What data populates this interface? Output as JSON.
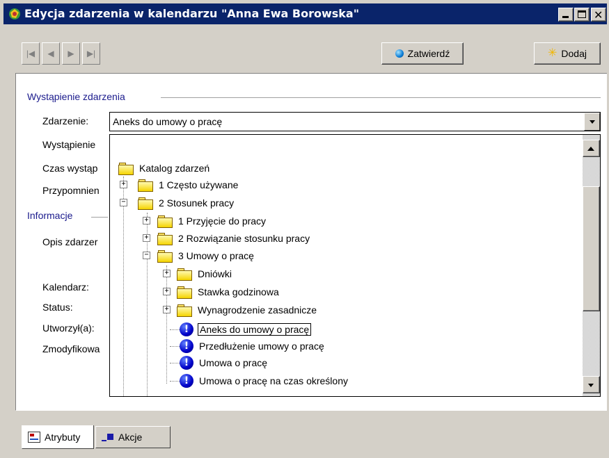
{
  "window": {
    "title": "Edycja zdarzenia w kalendarzu \"Anna Ewa Borowska\"",
    "titlebar_color": "#0a246a"
  },
  "toolbar": {
    "nav_first_icon": "first-record-icon",
    "nav_prev_icon": "previous-record-icon",
    "nav_next_icon": "next-record-icon",
    "nav_last_icon": "last-record-icon",
    "confirm_label": "Zatwierdź",
    "add_label": "Dodaj"
  },
  "sections": {
    "occurrence_title": "Wystąpienie zdarzenia",
    "info_title": "Informacje"
  },
  "fields": {
    "zdarzenie_label": "Zdarzenie:",
    "zdarzenie_value": "Aneks do umowy o pracę",
    "wystapienie_label": "Wystąpienie",
    "czas_label": "Czas wystąp",
    "przypomnienie_label": "Przypomnien",
    "opis_label": "Opis zdarzer",
    "kalendarz_label": "Kalendarz:",
    "status_label": "Status:",
    "utworzyl_label": "Utworzył(a):",
    "zmodyfikowal_label": "Zmodyfikowa"
  },
  "tree": {
    "root": "Katalog zdarzeń",
    "items": [
      {
        "label": "1 Często używane",
        "expander": "+"
      },
      {
        "label": "2 Stosunek pracy",
        "expander": "−"
      },
      {
        "label": "1 Przyjęcie do pracy",
        "expander": "+"
      },
      {
        "label": "2 Rozwiązanie stosunku pracy",
        "expander": "+"
      },
      {
        "label": "3 Umowy o pracę",
        "expander": "−"
      },
      {
        "label": "Dniówki",
        "expander": "+"
      },
      {
        "label": "Stawka godzinowa",
        "expander": "+"
      },
      {
        "label": "Wynagrodzenie zasadnicze",
        "expander": "+"
      },
      {
        "label": "Aneks do umowy o pracę",
        "selected": true
      },
      {
        "label": "Przedłużenie umowy o pracę"
      },
      {
        "label": "Umowa o pracę"
      },
      {
        "label": "Umowa o pracę na czas określony"
      }
    ]
  },
  "tabs": {
    "attributes_label": "Atrybuty",
    "actions_label": "Akcje"
  }
}
